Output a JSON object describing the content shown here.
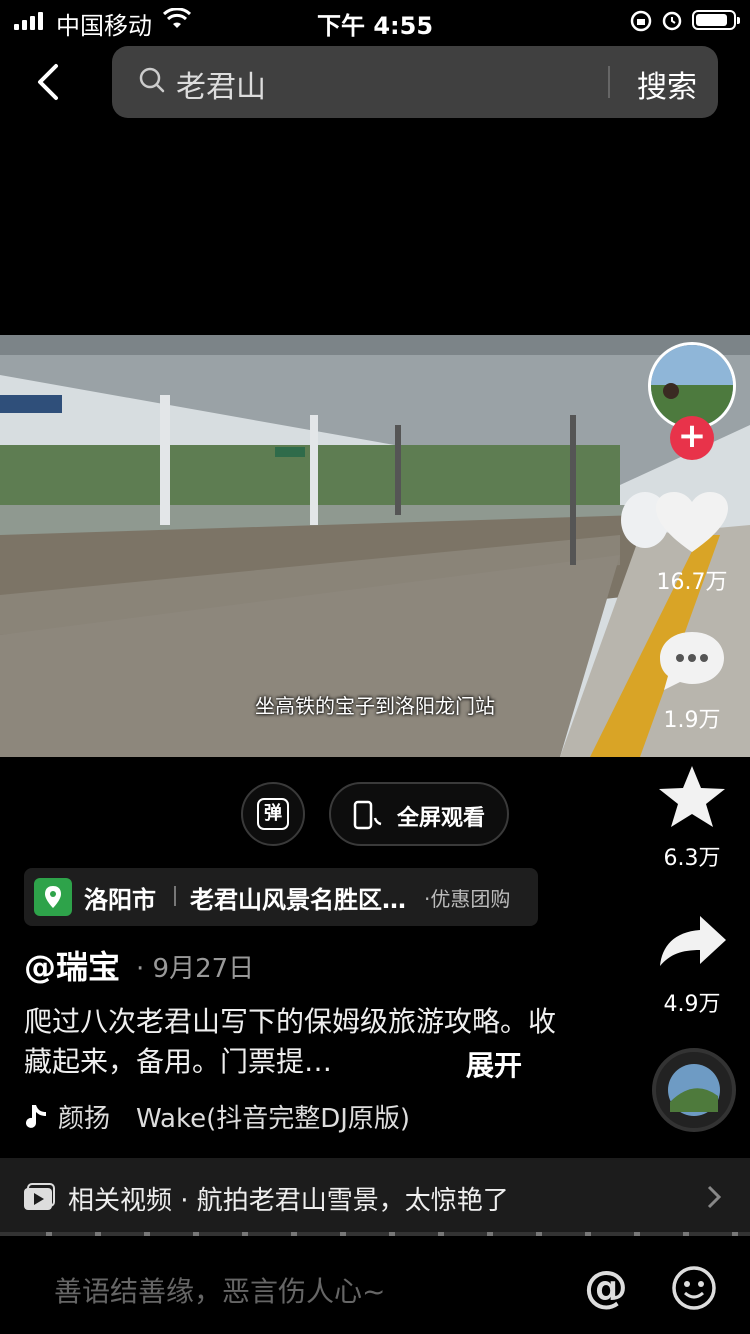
{
  "status_bar": {
    "carrier": "中国移动",
    "time": "下午 4:55",
    "battery_level": 0.85
  },
  "search": {
    "query": "老君山",
    "button": "搜索"
  },
  "video": {
    "subtitle": "坐高铁的宝子到洛阳龙门站"
  },
  "actions": {
    "likes": "16.7万",
    "comments": "1.9万",
    "favorites": "6.3万",
    "shares": "4.9万"
  },
  "buttons": {
    "danmaku": "弹",
    "fullscreen": "全屏观看"
  },
  "location": {
    "city": "洛阳市",
    "place": "老君山风景名胜区…",
    "deal": "·优惠团购"
  },
  "post": {
    "author": "@瑞宝",
    "date": "· 9月27日",
    "description": "爬过八次老君山写下的保姆级旅游攻略。收藏起来，备用。门票提…",
    "expand": "展开",
    "music": "颜扬　Wake(抖音完整DJ原版)"
  },
  "related": {
    "text": "相关视频 · 航拍老君山雪景，太惊艳了"
  },
  "comment_bar": {
    "placeholder": "善语结善缘，恶言伤人心~"
  },
  "icons": [
    "back-icon",
    "search-icon",
    "heart-icon",
    "comment-icon",
    "star-icon",
    "share-icon",
    "music-note-icon",
    "video-icon",
    "chevron-right-icon",
    "at-icon",
    "emoji-icon"
  ]
}
